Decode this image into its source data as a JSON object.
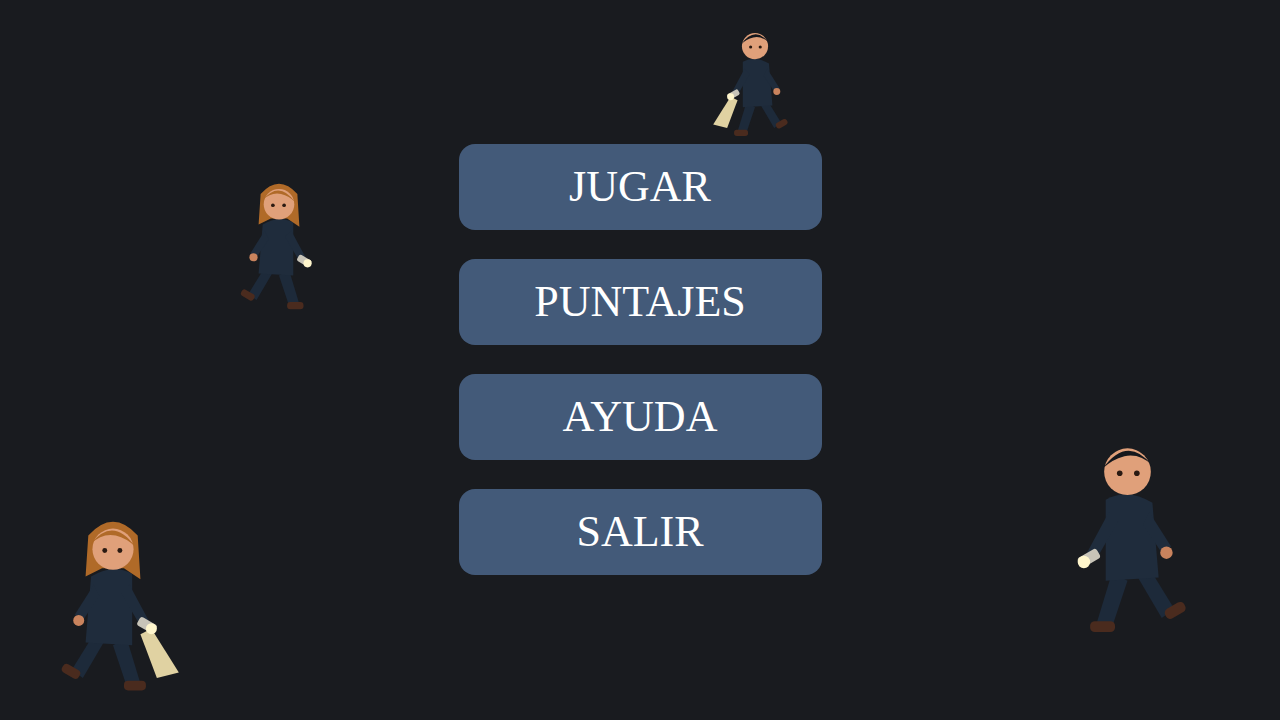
{
  "menu": {
    "buttons": [
      {
        "label": "JUGAR"
      },
      {
        "label": "PUNTAJES"
      },
      {
        "label": "AYUDA"
      },
      {
        "label": "SALIR"
      }
    ]
  }
}
